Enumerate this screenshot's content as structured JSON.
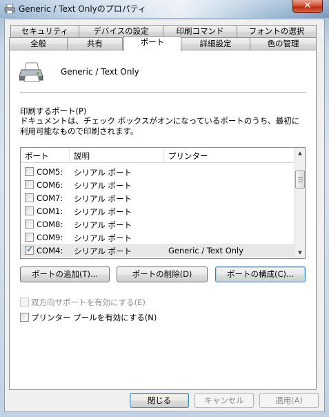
{
  "window": {
    "title": "Generic / Text Onlyのプロパティ",
    "close_glyph": "✕"
  },
  "tabs": {
    "row1": [
      "セキュリティ",
      "デバイスの設定",
      "印刷コマンド",
      "フォントの選択"
    ],
    "row2": [
      "全般",
      "共有",
      "ポート",
      "詳細設定",
      "色の管理"
    ],
    "active": "ポート"
  },
  "printer": {
    "name": "Generic / Text Only",
    "icon": "printer-icon"
  },
  "ports": {
    "label": "印刷するポート(P)",
    "description": "ドキュメントは、チェック ボックスがオンになっているポートのうち、最初に利用可能なもので印刷されます。",
    "columns": [
      "ポート",
      "説明",
      "プリンター"
    ],
    "rows": [
      {
        "port": "COM5:",
        "desc": "シリアル ポート",
        "printer": "",
        "checked": false
      },
      {
        "port": "COM6:",
        "desc": "シリアル ポート",
        "printer": "",
        "checked": false
      },
      {
        "port": "COM7:",
        "desc": "シリアル ポート",
        "printer": "",
        "checked": false
      },
      {
        "port": "COM1:",
        "desc": "シリアル ポート",
        "printer": "",
        "checked": false
      },
      {
        "port": "COM8:",
        "desc": "シリアル ポート",
        "printer": "",
        "checked": false
      },
      {
        "port": "COM9:",
        "desc": "シリアル ポート",
        "printer": "",
        "checked": false
      },
      {
        "port": "COM4:",
        "desc": "シリアル ポート",
        "printer": "Generic / Text Only",
        "checked": true
      }
    ]
  },
  "buttons": {
    "add_port": "ポートの追加(T)...",
    "delete_port": "ポートの削除(D)",
    "configure_port": "ポートの構成(C)..."
  },
  "options": {
    "bidirectional": "双方向サポートを有効にする(E)",
    "pooling": "プリンター プールを有効にする(N)"
  },
  "footer": {
    "close": "閉じる",
    "cancel": "キャンセル",
    "apply": "適用(A)"
  }
}
